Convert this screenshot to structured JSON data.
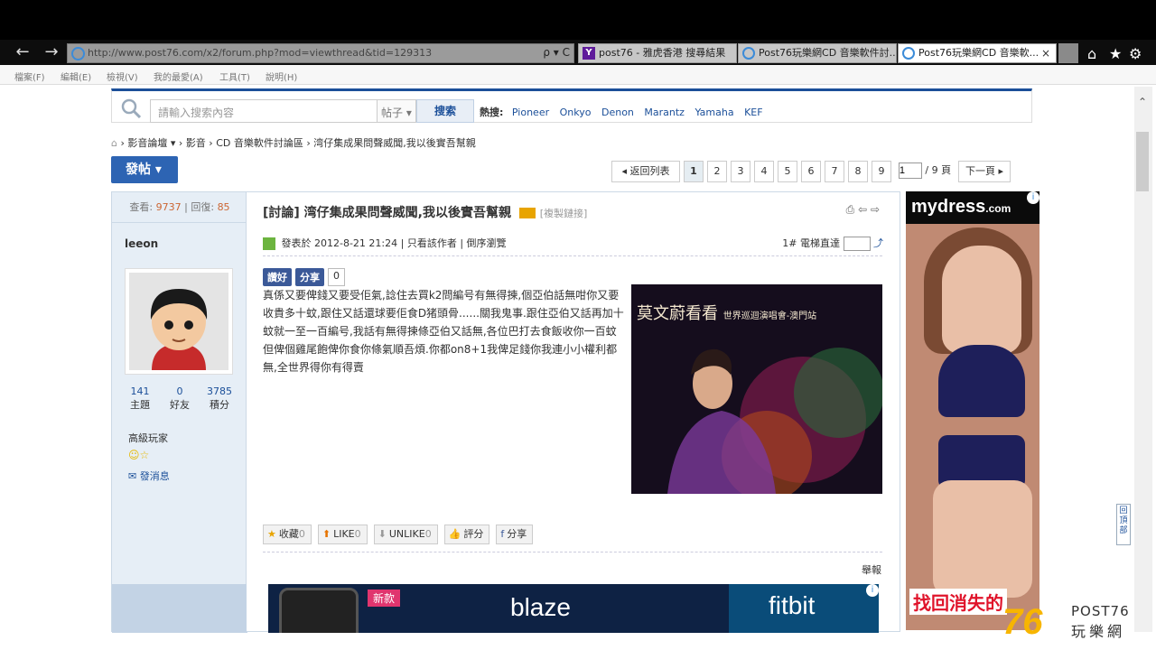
{
  "browser": {
    "url": "http://www.post76.com/x2/forum.php?mod=viewthread&tid=129313",
    "addr_controls": "ρ ▾ C",
    "tabs": [
      {
        "label": "post76 - 雅虎香港 搜尋結果",
        "active": false
      },
      {
        "label": "Post76玩樂網CD 音樂軟件討...",
        "active": false
      },
      {
        "label": "Post76玩樂網CD 音樂軟...",
        "active": true
      }
    ],
    "tab_close": "×",
    "menu": [
      "檔案(F)",
      "編輯(E)",
      "檢視(V)",
      "我的最愛(A)",
      "工具(T)",
      "說明(H)"
    ]
  },
  "search": {
    "placeholder": "請輸入搜索內容",
    "type": "帖子",
    "button": "搜索",
    "hot_label": "熱搜:",
    "hot": [
      "Pioneer",
      "Onkyo",
      "Denon",
      "Marantz",
      "Yamaha",
      "KEF"
    ]
  },
  "breadcrumb": [
    "影音論壇",
    "影音",
    "CD 音樂軟件討論區",
    "湾仔集成果問聲威聞,我以後實吾幫親"
  ],
  "post_button": "發帖",
  "pager": {
    "back": "返回列表",
    "pages": [
      "1",
      "2",
      "3",
      "4",
      "5",
      "6",
      "7",
      "8",
      "9"
    ],
    "current": "1",
    "total": "/ 9 頁",
    "next": "下一頁"
  },
  "thread_stats": {
    "views_label": "查看:",
    "views": "9737",
    "replies_label": "回復:",
    "replies": "85"
  },
  "author": {
    "name": "leeon",
    "topics": "141",
    "topics_label": "主題",
    "friends": "0",
    "friends_label": "好友",
    "points": "3785",
    "points_label": "積分",
    "rank": "高級玩家",
    "message": "發消息"
  },
  "post": {
    "title": "[討論] 湾仔集成果問聲威聞,我以後實吾幫親",
    "copy_link": "[複製鏈接]",
    "posted": "發表於 2012-8-21 21:24",
    "only_author": "只看該作者",
    "reverse": "倒序瀏覽",
    "floor": "1#",
    "floor_jump": "電梯直達",
    "fb_like": "讚好",
    "fb_share": "分享",
    "fb_count": "0",
    "body": "真係又要俾錢又要受佢氣,諗住去買k2問編号有無得揀,個亞伯話無咁你又要收貴多十蚊,跟住又話還球要佢食D猪頭骨......關我鬼事.跟住亞伯又話再加十蚊就一至一百編号,我話有無得揀條亞伯又話無,各位巴打去食飯收你一百蚊但俾個雞尾飽俾你食你條氣順吾煩.你都on8+1我俾足錢你我連小小權利都無,全世界得你有得賣",
    "image_text": "莫文蔚看看",
    "image_sub": "世界巡迴演唱會-澳門站",
    "report": "舉報"
  },
  "actions": [
    {
      "label": "收藏",
      "count": "0"
    },
    {
      "label": "LIKE",
      "count": "0"
    },
    {
      "label": "UNLIKE",
      "count": "0"
    },
    {
      "label": "評分",
      "count": ""
    },
    {
      "label": "分享",
      "count": ""
    }
  ],
  "ads": {
    "side_brand": "mydress",
    "side_brand_tld": ".com",
    "side_slogan": "找回消失的",
    "bottom_new": "新款",
    "bottom_product": "blaze",
    "bottom_brand": "fitbit"
  },
  "to_top": "回頂部",
  "watermark": {
    "number": "76",
    "latin": "POST76",
    "chinese": "玩樂網"
  }
}
